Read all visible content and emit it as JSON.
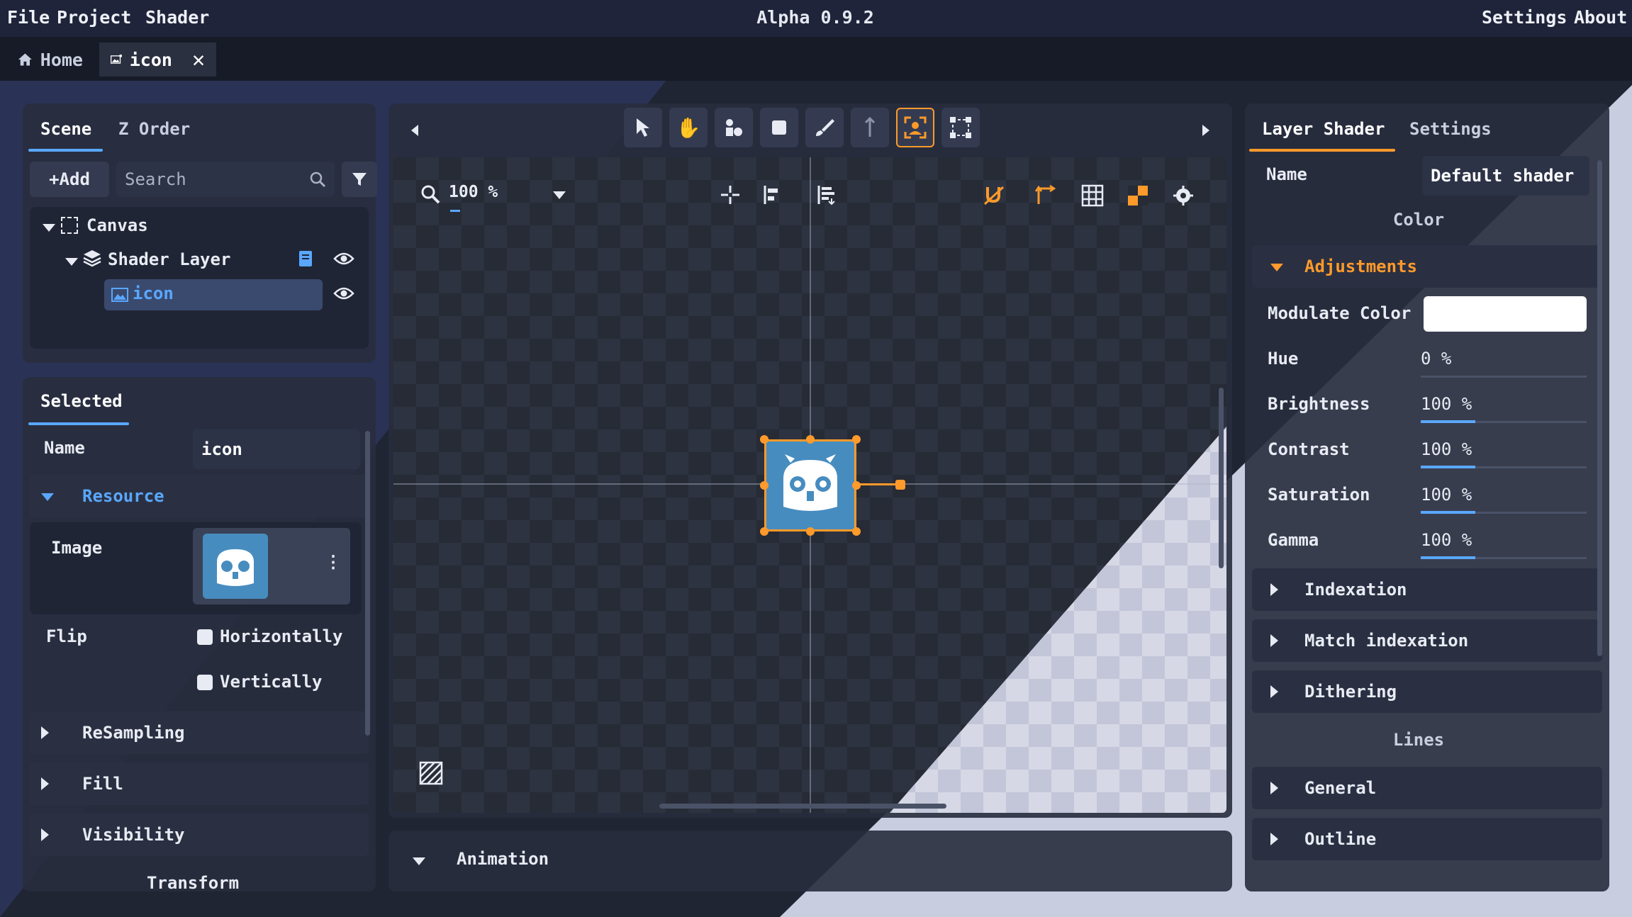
{
  "menu": {
    "file": "File",
    "project": "Project",
    "shader": "Shader",
    "settings": "Settings",
    "about": "About"
  },
  "app_title": "Alpha 0.9.2",
  "tabs": {
    "home": "Home",
    "doc": "icon"
  },
  "scene_panel": {
    "tab_scene": "Scene",
    "tab_zorder": "Z Order",
    "add_label": "+Add",
    "search_placeholder": "Search",
    "tree": {
      "canvas": "Canvas",
      "shader_layer": "Shader Layer",
      "icon": "icon"
    }
  },
  "selected_panel": {
    "title": "Selected",
    "name_label": "Name",
    "name_value": "icon",
    "resource": "Resource",
    "image_label": "Image",
    "flip_label": "Flip",
    "horizontally": "Horizontally",
    "vertically": "Vertically",
    "resampling": "ReSampling",
    "fill": "Fill",
    "visibility": "Visibility",
    "transform": "Transform"
  },
  "viewport": {
    "zoom": "100 %"
  },
  "animation_label": "Animation",
  "right_panel": {
    "tab_layer_shader": "Layer Shader",
    "tab_settings": "Settings",
    "name_label": "Name",
    "name_value": "Default shader",
    "color_heading": "Color",
    "adjustments": "Adjustments",
    "modulate_color": "Modulate Color",
    "hue_label": "Hue",
    "hue_value": "0 %",
    "hue_fraction": 0,
    "brightness_label": "Brightness",
    "brightness_value": "100 %",
    "brightness_fraction": 0.33,
    "contrast_label": "Contrast",
    "contrast_value": "100 %",
    "contrast_fraction": 0.33,
    "saturation_label": "Saturation",
    "saturation_value": "100 %",
    "saturation_fraction": 0.33,
    "gamma_label": "Gamma",
    "gamma_value": "100 %",
    "gamma_fraction": 0.33,
    "indexation": "Indexation",
    "match_indexation": "Match indexation",
    "dithering": "Dithering",
    "lines_heading": "Lines",
    "general": "General",
    "outline": "Outline"
  },
  "colors": {
    "accent": "#5aa7ff",
    "highlight": "#ff9a2b",
    "modulate": "#ffffff"
  }
}
